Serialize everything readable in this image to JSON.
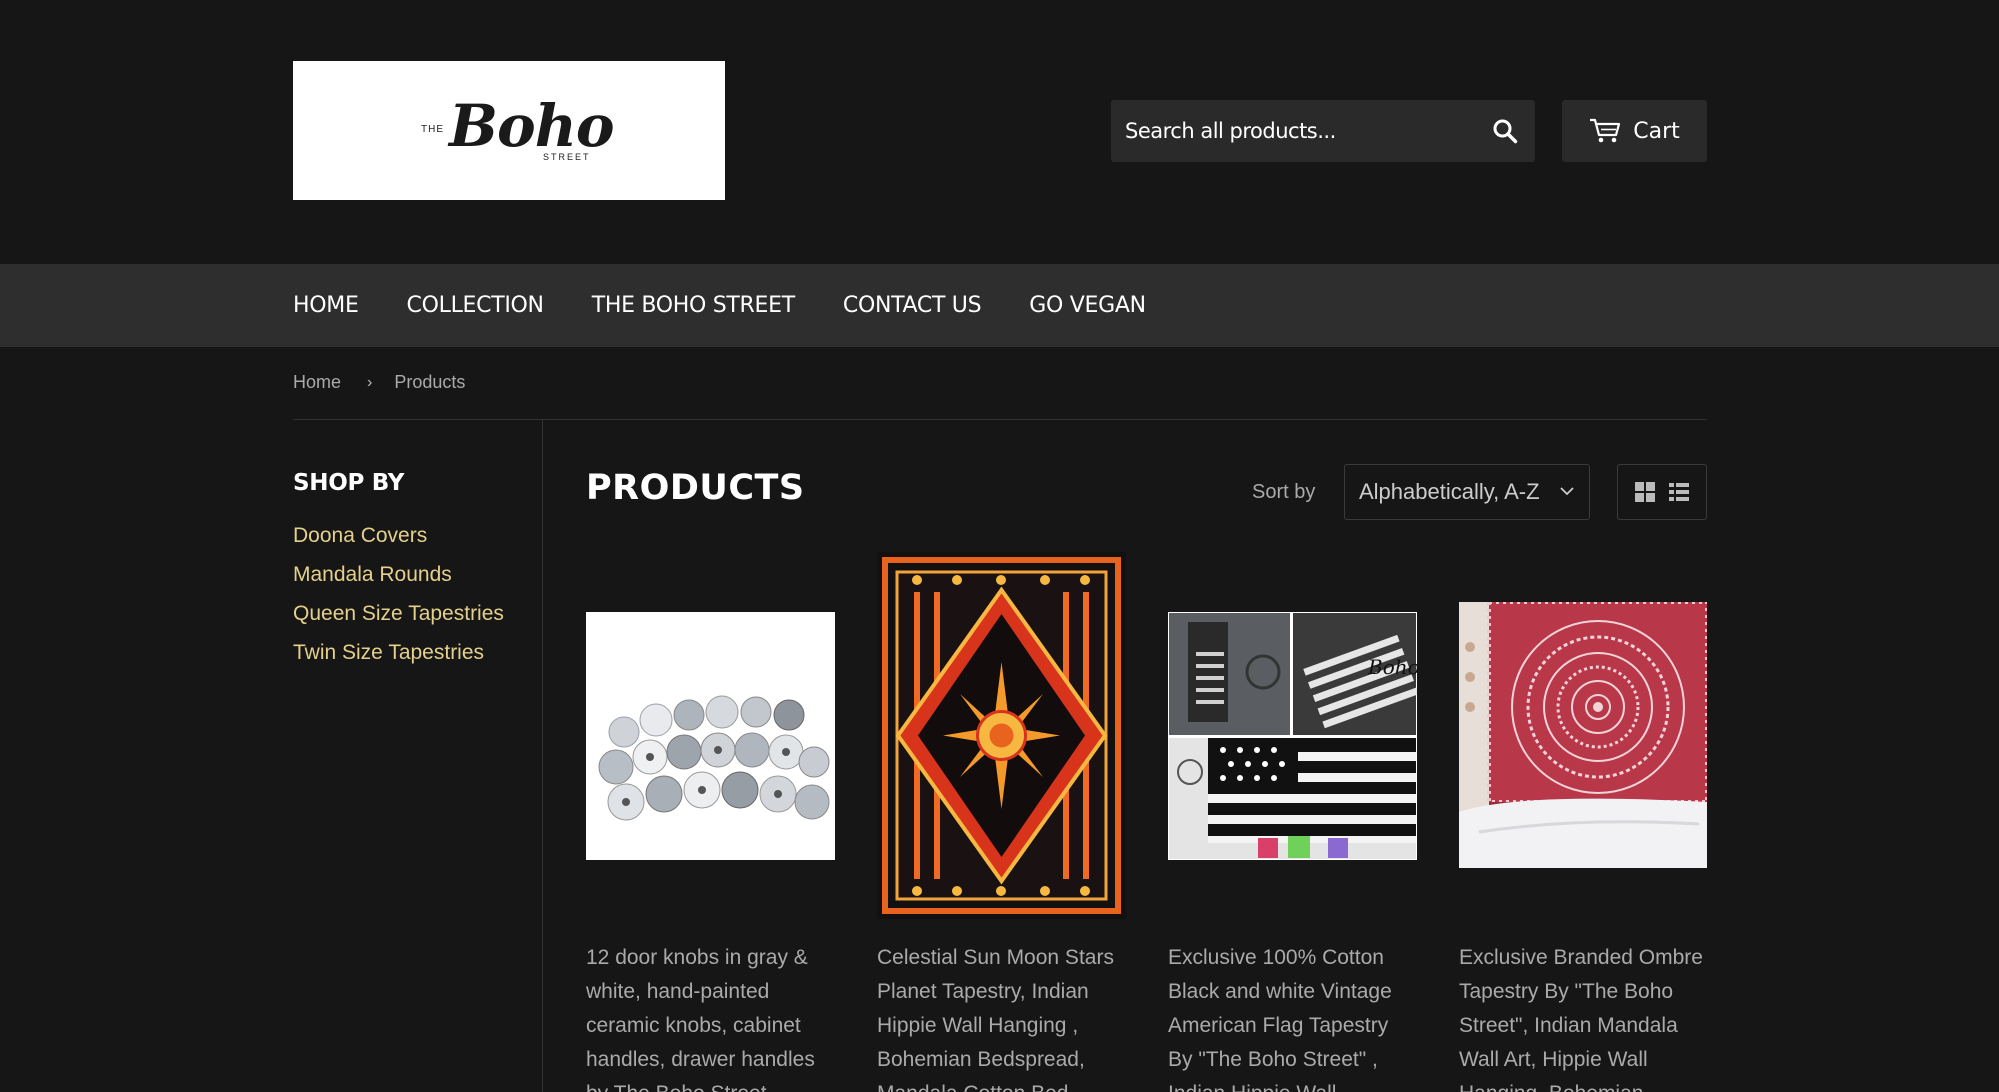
{
  "header": {
    "logo": {
      "the": "THE",
      "boho": "Boho",
      "street": "STREET"
    },
    "search": {
      "placeholder": "Search all products..."
    },
    "cart": {
      "label": "Cart"
    }
  },
  "nav": {
    "items": [
      {
        "label": "HOME"
      },
      {
        "label": "COLLECTION"
      },
      {
        "label": "THE BOHO STREET"
      },
      {
        "label": "CONTACT US"
      },
      {
        "label": "GO VEGAN"
      }
    ]
  },
  "breadcrumb": {
    "home": "Home",
    "separator": "›",
    "current": "Products"
  },
  "sidebar": {
    "heading": "SHOP BY",
    "items": [
      {
        "label": "Doona Covers"
      },
      {
        "label": "Mandala Rounds"
      },
      {
        "label": "Queen Size Tapestries"
      },
      {
        "label": "Twin Size Tapestries"
      }
    ]
  },
  "main": {
    "title": "PRODUCTS",
    "sort": {
      "label": "Sort by",
      "value": "Alphabetically, A-Z"
    },
    "products": [
      {
        "title": "12 door knobs in gray & white, hand-painted ceramic knobs, cabinet handles, drawer handles by The Boho Street"
      },
      {
        "title": "Celestial Sun Moon Stars Planet Tapestry, Indian Hippie Wall Hanging , Bohemian Bedspread, Mandala Cotton Bed"
      },
      {
        "title": "Exclusive 100% Cotton Black and white Vintage American Flag Tapestry By \"The Boho Street\" , Indian Hippie Wall"
      },
      {
        "title": "Exclusive Branded Ombre Tapestry By \"The Boho Street\", Indian Mandala Wall Art, Hippie Wall Hanging, Bohemian"
      }
    ]
  },
  "colors": {
    "background": "#161616",
    "nav": "#2e2e2e",
    "link": "#e4d08a",
    "input": "#2a2a2a"
  }
}
